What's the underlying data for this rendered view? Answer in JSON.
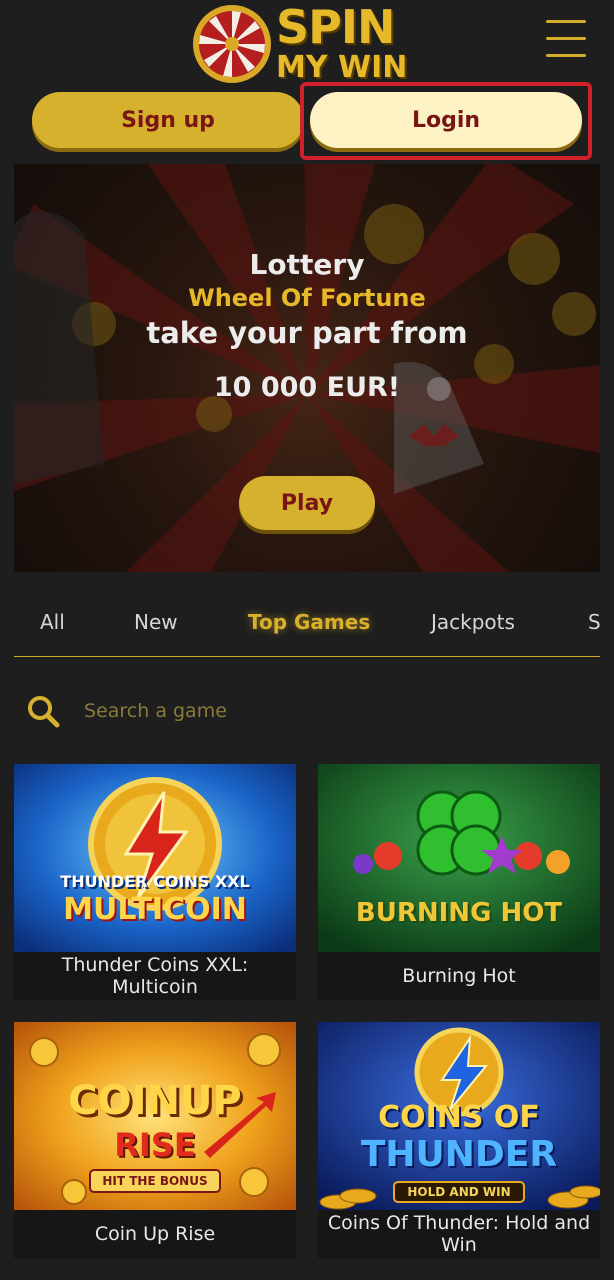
{
  "header": {
    "logo_line1": "SPIN",
    "logo_line2": "MY WIN",
    "menu_icon": "hamburger-menu-icon"
  },
  "auth": {
    "signup_label": "Sign up",
    "login_label": "Login"
  },
  "banner": {
    "title": "Lottery",
    "subtitle": "Wheel Of Fortune",
    "line": "take your part from",
    "amount": "10 000 EUR!",
    "play_label": "Play"
  },
  "tabs": [
    {
      "label": "All",
      "active": false
    },
    {
      "label": "New",
      "active": false
    },
    {
      "label": "Top Games",
      "active": true
    },
    {
      "label": "Jackpots",
      "active": false
    },
    {
      "label": "S",
      "active": false
    }
  ],
  "search": {
    "placeholder": "Search a game",
    "icon": "search-icon"
  },
  "games": [
    {
      "name": "Thunder Coins XXL: Multicoin",
      "art_line1": "THUNDER COINS XXL",
      "art_line2": "MULTICOIN"
    },
    {
      "name": "Burning Hot",
      "art_line1": "BURNING HOT"
    },
    {
      "name": "Coin Up Rise",
      "art_line1": "COINUP",
      "art_line2": "RISE",
      "art_line3": "HIT THE BONUS"
    },
    {
      "name": "Coins Of Thunder: Hold and Win",
      "art_line1": "COINS OF",
      "art_line2": "THUNDER",
      "art_line3": "HOLD AND WIN"
    }
  ],
  "colors": {
    "accent_gold": "#d5b12e",
    "button_text": "#7a1515",
    "highlight_red": "#d0202a",
    "background": "#1e1e1e"
  }
}
